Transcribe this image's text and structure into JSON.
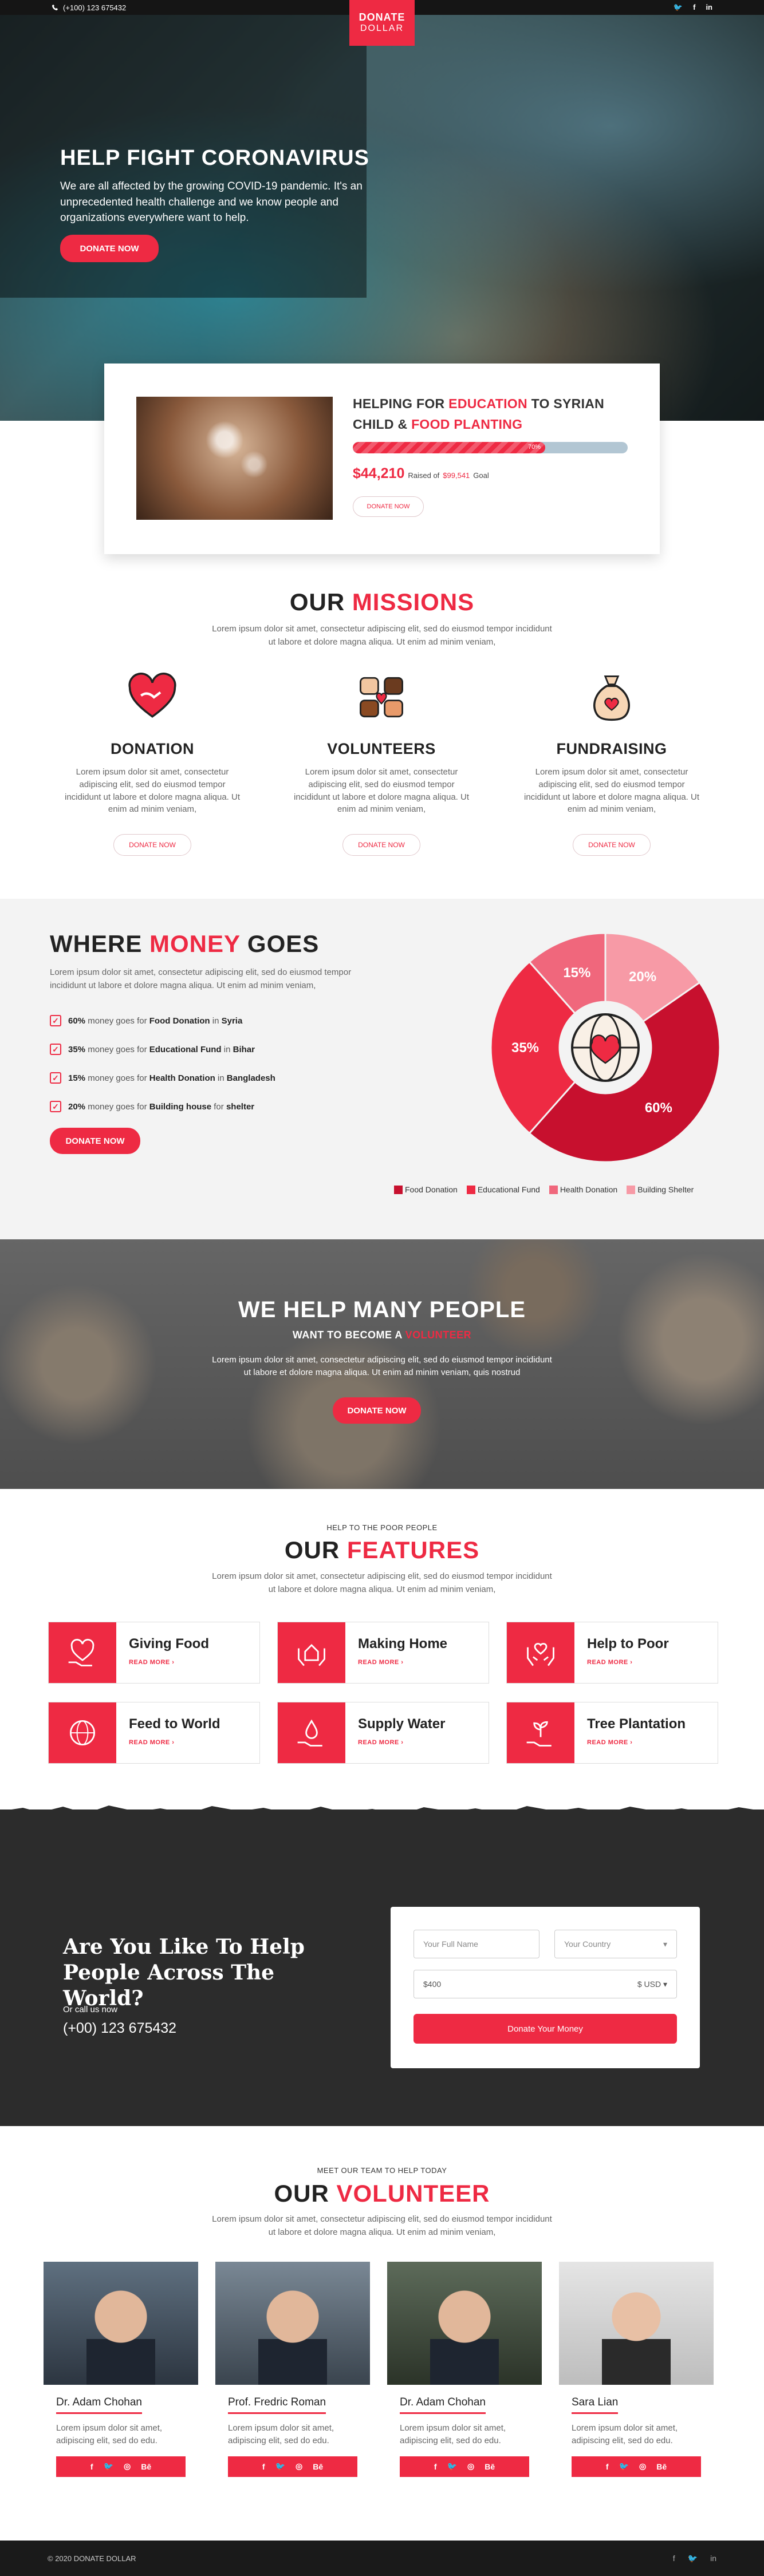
{
  "topbar": {
    "phone": "(+100) 123 675432",
    "socials": [
      "twitter-icon",
      "facebook-icon",
      "linkedin-icon"
    ]
  },
  "logo": {
    "line1": "DONATE",
    "line2": "DOLLAR"
  },
  "hero": {
    "title": "HELP FIGHT CORONAVIRUS",
    "text": "We are all affected by the growing COVID-19 pandemic. It's an unprecedented health challenge and we know people and organizations everywhere want to help.",
    "button": "DONATE NOW"
  },
  "campaign": {
    "title_a": "HELPING FOR ",
    "title_b": "EDUCATION",
    "title_c": " TO SYRIAN CHILD & ",
    "title_d": "FOOD PLANTING",
    "progress": 0.7,
    "progress_label": "70%",
    "raised_amount": "$44,210",
    "raised_label": "Raised of",
    "goal_amount": "$99,541",
    "goal_label": "Goal",
    "button": "DONATE NOW"
  },
  "missions": {
    "title_a": "OUR ",
    "title_b": "MISSIONS",
    "subtitle": "Lorem ipsum dolor sit amet, consectetur adipiscing elit, sed do eiusmod tempor incididunt ut labore et dolore magna aliqua. Ut enim ad minim veniam,",
    "items": [
      {
        "icon": "heart-hand-icon",
        "title": "DONATION",
        "text": "Lorem ipsum dolor sit amet, consectetur adipiscing elit, sed do eiusmod tempor incididunt ut labore et dolore magna aliqua. Ut enim ad minim veniam,",
        "button": "DONATE NOW"
      },
      {
        "icon": "helping-hands-icon",
        "title": "VOLUNTEERS",
        "text": "Lorem ipsum dolor sit amet, consectetur adipiscing elit, sed do eiusmod tempor incididunt ut labore et dolore magna aliqua. Ut enim ad minim veniam,",
        "button": "DONATE NOW"
      },
      {
        "icon": "money-bag-icon",
        "title": "FUNDRAISING",
        "text": "Lorem ipsum dolor sit amet, consectetur adipiscing elit, sed do eiusmod tempor incididunt ut labore et dolore magna aliqua. Ut enim ad minim veniam,",
        "button": "DONATE NOW"
      }
    ]
  },
  "money": {
    "title_a": "WHERE ",
    "title_b": "MONEY",
    "title_c": " GOES",
    "subtitle": "Lorem ipsum dolor sit amet, consectetur adipiscing elit, sed do eiusmod tempor incididunt ut labore et dolore magna aliqua. Ut enim ad minim veniam,",
    "items": [
      {
        "pct": "60%",
        "mid": " money goes for ",
        "what": "Food Donation",
        "prep": " in ",
        "where": "Syria"
      },
      {
        "pct": "35%",
        "mid": " money goes for ",
        "what": "Educational Fund",
        "prep": " in ",
        "where": "Bihar"
      },
      {
        "pct": "15%",
        "mid": " money goes for ",
        "what": "Health Donation",
        "prep": " in ",
        "where": "Bangladesh"
      },
      {
        "pct": "20%",
        "mid": " money goes for ",
        "what": "Building house",
        "prep": " for ",
        "where": "shelter"
      }
    ],
    "button": "DONATE NOW"
  },
  "chart_data": {
    "type": "pie",
    "categories": [
      "Food Donation",
      "Educational Fund",
      "Health Donation",
      "Building Shelter"
    ],
    "values": [
      60,
      35,
      15,
      20
    ],
    "labels": [
      "60%",
      "35%",
      "15%",
      "20%"
    ],
    "colors": [
      "#c7102e",
      "#ee2a43",
      "#f0677c",
      "#f79aa6"
    ],
    "legend_placement": "bottom"
  },
  "volunteer_banner": {
    "title": "WE HELP MANY PEOPLE",
    "subtitle_a": "WANT TO BECOME A ",
    "subtitle_b": "VOLUNTEER",
    "text": "Lorem ipsum dolor sit amet, consectetur adipiscing elit, sed do eiusmod tempor incididunt ut labore et dolore magna aliqua. Ut enim ad minim veniam, quis nostrud",
    "button": "DONATE NOW"
  },
  "features": {
    "kicker": "HELP TO THE POOR PEOPLE",
    "title_a": "OUR ",
    "title_b": "FEATURES",
    "subtitle": "Lorem ipsum dolor sit amet, consectetur adipiscing elit, sed do eiusmod tempor incididunt ut labore et dolore magna aliqua. Ut enim ad minim veniam,",
    "items": [
      {
        "icon": "heart-hand-icon",
        "title": "Giving Food",
        "link": "READ MORE ›"
      },
      {
        "icon": "home-hands-icon",
        "title": "Making Home",
        "link": "READ MORE ›"
      },
      {
        "icon": "help-hands-icon",
        "title": "Help to Poor",
        "link": "READ MORE ›"
      },
      {
        "icon": "globe-heart-icon",
        "title": "Feed to World",
        "link": "READ MORE ›"
      },
      {
        "icon": "water-hand-icon",
        "title": "Supply Water",
        "link": "READ MORE ›"
      },
      {
        "icon": "plant-hand-icon",
        "title": "Tree Plantation",
        "link": "READ MORE ›"
      }
    ]
  },
  "cta": {
    "title": "Are You Like To Help People Across The World?",
    "or_call": "Or call us now",
    "phone": "(+00) 123 675432",
    "name_placeholder": "Your Full Name",
    "country_placeholder": "Your Country",
    "amount_value": "$400",
    "currency": "$ USD",
    "button": "Donate Your Money"
  },
  "team": {
    "kicker": "MEET OUR TEAM TO HELP TODAY",
    "title_a": "OUR ",
    "title_b": "VOLUNTEER",
    "subtitle": "Lorem ipsum dolor sit amet, consectetur adipiscing elit, sed do eiusmod tempor incididunt ut labore et dolore magna aliqua. Ut enim ad minim veniam,",
    "members": [
      {
        "name": "Dr. Adam Chohan",
        "bio": "Lorem ipsum dolor sit amet, adipiscing elit, sed do edu."
      },
      {
        "name": "Prof. Fredric Roman",
        "bio": "Lorem ipsum dolor sit amet, adipiscing elit, sed do edu."
      },
      {
        "name": "Dr. Adam Chohan",
        "bio": "Lorem ipsum dolor sit amet, adipiscing elit, sed do edu."
      },
      {
        "name": "Sara Lian",
        "bio": "Lorem ipsum dolor sit amet, adipiscing elit, sed do edu."
      }
    ],
    "social_glyphs": [
      "f",
      "🐦",
      "◎",
      "Bē"
    ]
  },
  "footer": {
    "copyright": "© 2020 DONATE DOLLAR",
    "socials": [
      "facebook-icon",
      "twitter-icon",
      "linkedin-icon"
    ]
  }
}
